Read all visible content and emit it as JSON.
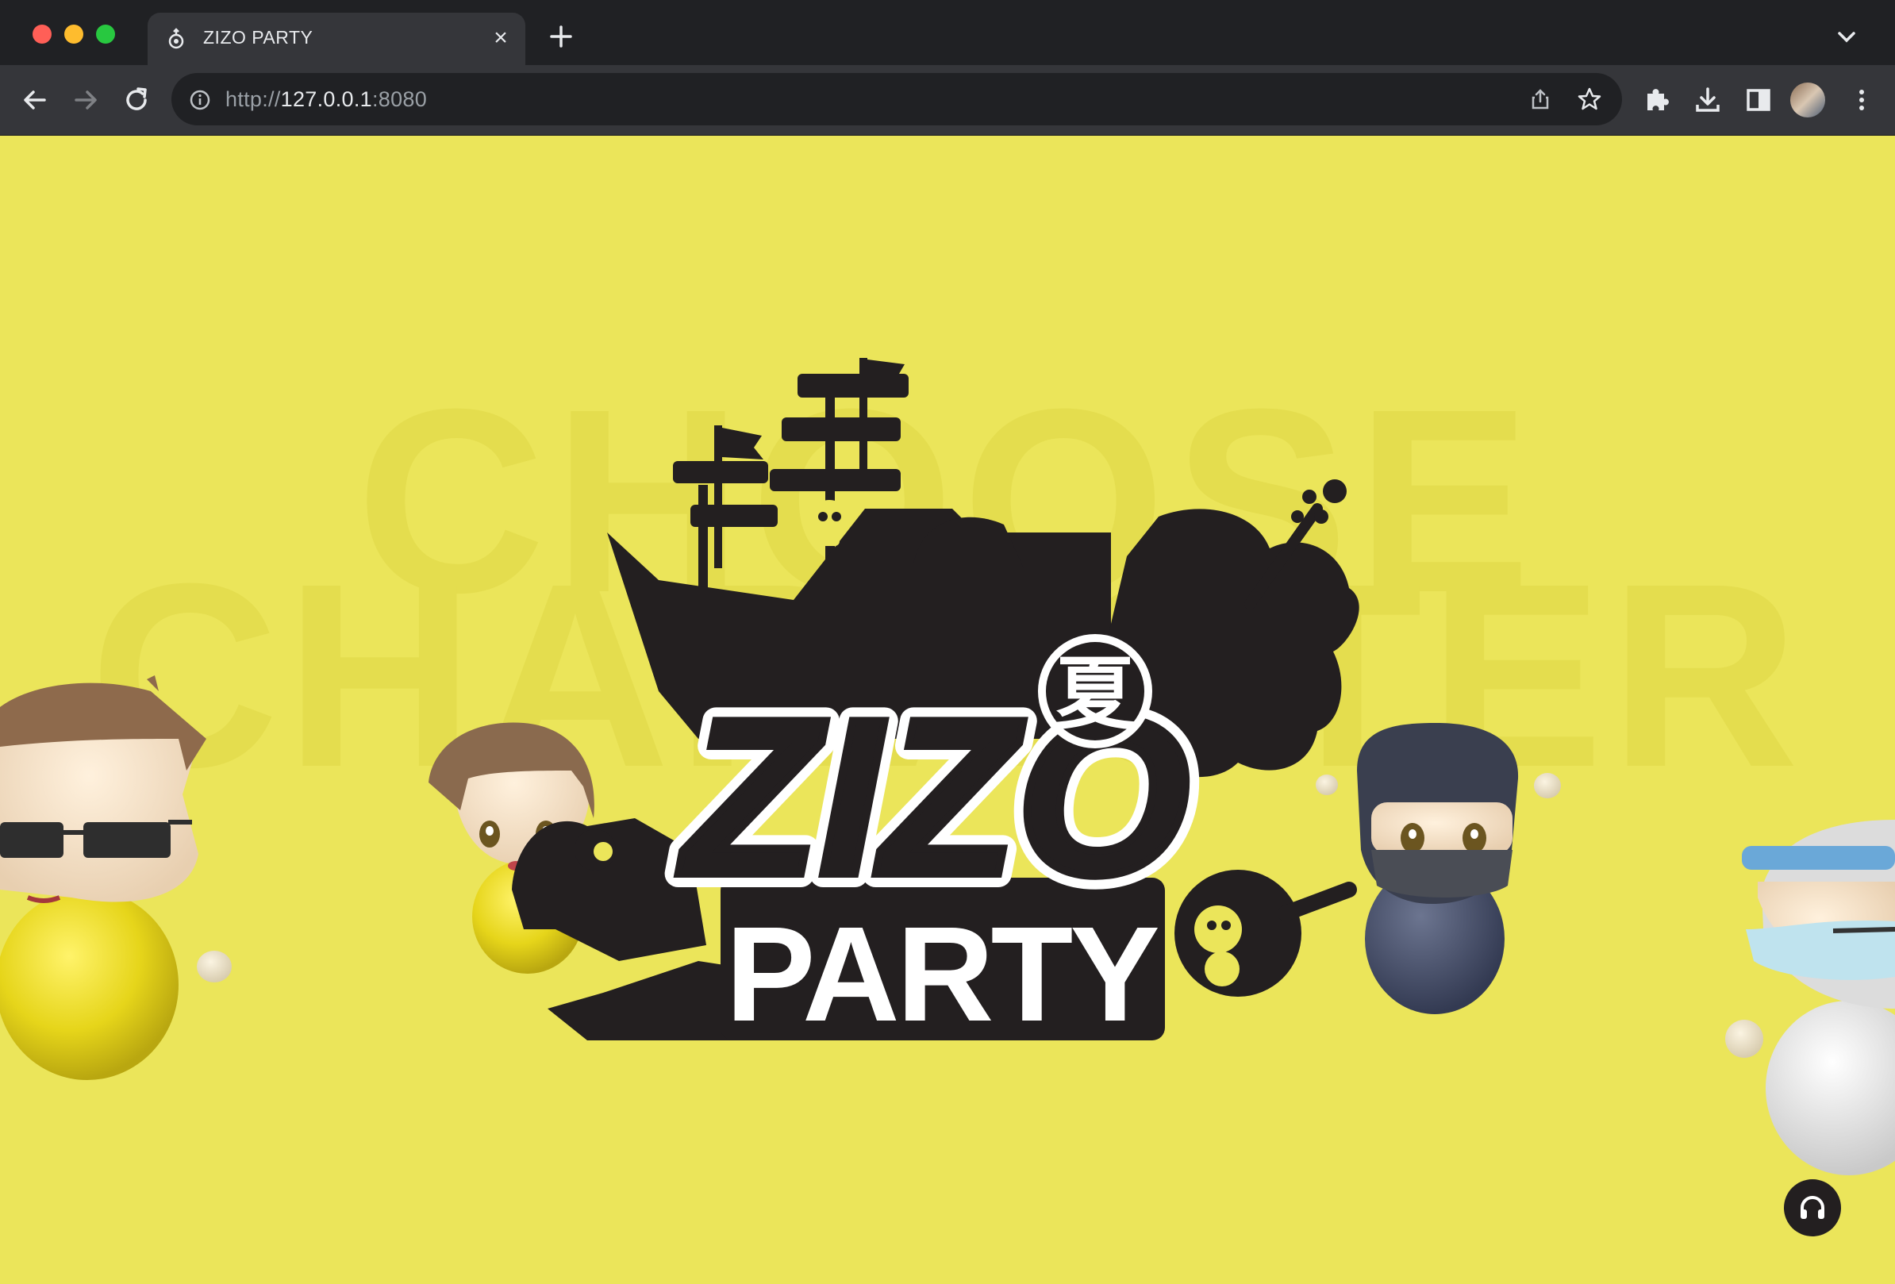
{
  "browser": {
    "tab_title": "ZIZO PARTY",
    "tab_close": "×",
    "url_scheme": "http://",
    "url_host": "127.0.0.1",
    "url_port": ":8080"
  },
  "page": {
    "bg_line1": "CHOOSE",
    "bg_line2": "CHARACTER",
    "logo_kanji": "夏",
    "logo_zizo": "ZIZO",
    "logo_party": "PARTY"
  },
  "colors": {
    "page_background": "#ebe55a",
    "logo_black": "#231f20",
    "chrome_dark": "#202124",
    "chrome_toolbar": "#35363a"
  },
  "icons": [
    "back-arrow-icon",
    "forward-arrow-icon",
    "reload-icon",
    "info-icon",
    "share-icon",
    "star-icon",
    "puzzle-icon",
    "download-icon",
    "sidepanel-icon",
    "more-vert-icon",
    "plus-icon",
    "chevron-down-icon",
    "headphones-icon"
  ]
}
